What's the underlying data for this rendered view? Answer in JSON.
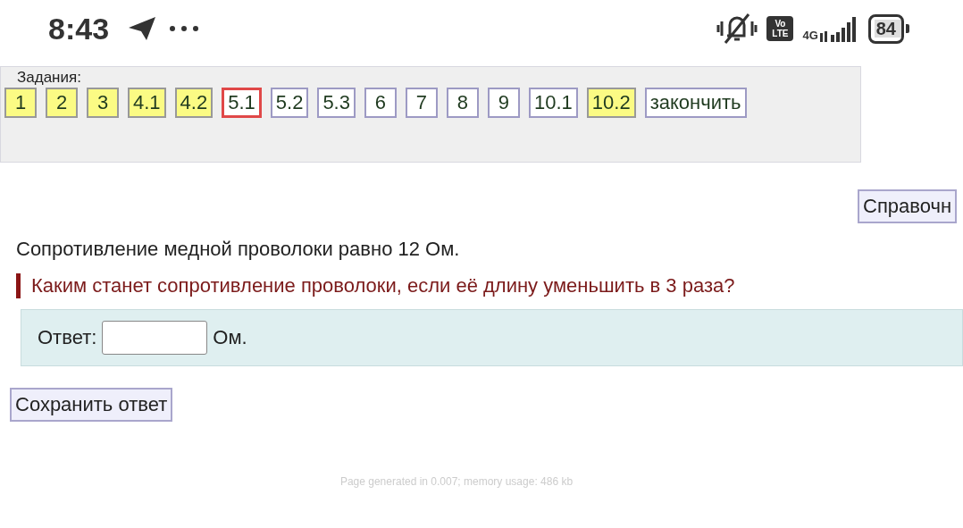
{
  "status_bar": {
    "time": "8:43",
    "volte": "Vo LTE",
    "network": "4G",
    "battery": "84"
  },
  "tasks": {
    "label": "Задания:",
    "items": [
      {
        "label": "1",
        "done": true,
        "selected": false
      },
      {
        "label": "2",
        "done": true,
        "selected": false
      },
      {
        "label": "3",
        "done": true,
        "selected": false
      },
      {
        "label": "4.1",
        "done": true,
        "selected": false
      },
      {
        "label": "4.2",
        "done": true,
        "selected": false
      },
      {
        "label": "5.1",
        "done": false,
        "selected": true
      },
      {
        "label": "5.2",
        "done": false,
        "selected": false
      },
      {
        "label": "5.3",
        "done": false,
        "selected": false
      },
      {
        "label": "6",
        "done": false,
        "selected": false
      },
      {
        "label": "7",
        "done": false,
        "selected": false
      },
      {
        "label": "8",
        "done": false,
        "selected": false
      },
      {
        "label": "9",
        "done": false,
        "selected": false
      },
      {
        "label": "10.1",
        "done": false,
        "selected": false
      },
      {
        "label": "10.2",
        "done": true,
        "selected": false
      }
    ],
    "finish_button": "закончить"
  },
  "reference_button": "Справочн",
  "statement": "Сопротивление медной проволоки равно 12 Ом.",
  "question": "Каким станет сопротивление проволоки, если её длину уменьшить в 3 раза?",
  "answer": {
    "label": "Ответ:",
    "unit": "Ом."
  },
  "save_button": "Сохранить ответ",
  "footer": "Page generated in 0.007; memory usage: 486 kb"
}
